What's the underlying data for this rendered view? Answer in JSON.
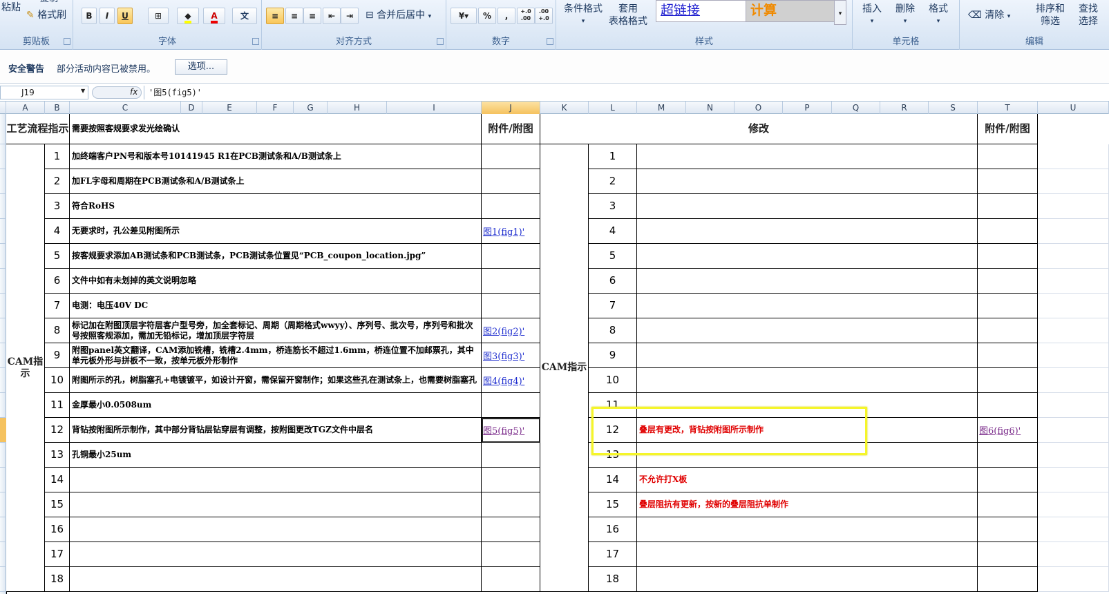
{
  "ribbon": {
    "paste_label": "粘贴",
    "copy_label": "复制",
    "format_painter_label": "格式刷",
    "clipboard_group": "剪贴板",
    "font_group": "字体",
    "alignment_group": "对齐方式",
    "merge_center_label": "合并后居中",
    "number_group": "数字",
    "percent_label": "%",
    "comma_label": ",",
    "styles_group": "样式",
    "conditional_format_label": "条件格式",
    "table_format_label1": "套用",
    "table_format_label2": "表格格式",
    "hyperlink_style": "超链接",
    "calc_style": "计算",
    "cells_group": "单元格",
    "insert_label": "插入",
    "delete_label": "删除",
    "format_label": "格式",
    "editing_group": "编辑",
    "clear_label": "清除",
    "sort_label1": "排序和",
    "sort_label2": "筛选",
    "find_label1": "查找",
    "find_label2": "选择",
    "bold": "B",
    "italic": "I",
    "underline": "U",
    "font_color_letter": "A",
    "wen_char": "文",
    "decimal_inc": "+.0 .00",
    "decimal_dec": ".00 +.0"
  },
  "security": {
    "title": "安全警告",
    "message": "部分活动内容已被禁用。",
    "options_button": "选项..."
  },
  "formula_bar": {
    "name_box": "J19",
    "fx": "fx",
    "formula": "'图5(fig5)'"
  },
  "columns": [
    "A",
    "B",
    "C",
    "D",
    "E",
    "F",
    "G",
    "H",
    "I",
    "J",
    "K",
    "L",
    "M",
    "N",
    "O",
    "P",
    "Q",
    "R",
    "S",
    "T",
    "U"
  ],
  "sheet": {
    "left_header_process": "工艺流程指示",
    "left_header_desc": "需要按照客规要求发光绘确认",
    "left_header_attach": "附件/附图",
    "right_header_modify": "修改",
    "right_header_attach": "附件/附图",
    "left_group_label": "CAM指示",
    "right_group_label": "CAM指示",
    "left_rows": [
      {
        "num": "1",
        "text": "加终端客户PN号和版本号10141945 R1在PCB测试条和A/B测试条上",
        "link": ""
      },
      {
        "num": "2",
        "text": "加FL字母和周期在PCB测试条和A/B测试条上",
        "link": ""
      },
      {
        "num": "3",
        "text": "符合RoHS",
        "link": ""
      },
      {
        "num": "4",
        "text": "无要求时，孔公差见附图所示",
        "link": "图1(fig1)'"
      },
      {
        "num": "5",
        "text": "按客规要求添加AB测试条和PCB测试条，PCB测试条位置见“PCB_coupon_location.jpg”",
        "link": ""
      },
      {
        "num": "6",
        "text": "文件中如有未划掉的英文说明忽略",
        "link": ""
      },
      {
        "num": "7",
        "text": "电测：电压40V DC",
        "link": ""
      },
      {
        "num": "8",
        "text": "标记加在附图顶层字符层客户型号旁，加全套标记、周期（周期格式wwyy）、序列号、批次号，序列号和批次号按照客规添加，需加无铅标记，增加顶层字符层",
        "link": "图2(fig2)'"
      },
      {
        "num": "9",
        "text": "附图panel英文翻译，CAM添加铣槽，铣槽2.4mm，桥连筋长不超过1.6mm，桥连位置不加邮票孔，其中单元板外形与拼板不一致，按单元板外形制作",
        "link": "图3(fig3)'"
      },
      {
        "num": "10",
        "text": "附图所示的孔，树脂塞孔+电镀镀平，如设计开窗，需保留开窗制作；如果这些孔在测试条上，也需要树脂塞孔",
        "link": "图4(fig4)'"
      },
      {
        "num": "11",
        "text": "金厚最小0.0508um",
        "link": ""
      },
      {
        "num": "12",
        "text": "背钻按附图所示制作，其中部分背钻层钻穿层有调整，按附图更改TGZ文件中层名",
        "link": "图5(fig5)'"
      },
      {
        "num": "13",
        "text": "孔铜最小25um",
        "link": ""
      },
      {
        "num": "14",
        "text": "",
        "link": ""
      },
      {
        "num": "15",
        "text": "",
        "link": ""
      },
      {
        "num": "16",
        "text": "",
        "link": ""
      },
      {
        "num": "17",
        "text": "",
        "link": ""
      },
      {
        "num": "18",
        "text": "",
        "link": ""
      }
    ],
    "right_rows": [
      {
        "num": "1",
        "text": "",
        "link": ""
      },
      {
        "num": "2",
        "text": "",
        "link": ""
      },
      {
        "num": "3",
        "text": "",
        "link": ""
      },
      {
        "num": "4",
        "text": "",
        "link": ""
      },
      {
        "num": "5",
        "text": "",
        "link": ""
      },
      {
        "num": "6",
        "text": "",
        "link": ""
      },
      {
        "num": "7",
        "text": "",
        "link": ""
      },
      {
        "num": "8",
        "text": "",
        "link": ""
      },
      {
        "num": "9",
        "text": "",
        "link": ""
      },
      {
        "num": "10",
        "text": "",
        "link": ""
      },
      {
        "num": "11",
        "text": "",
        "link": ""
      },
      {
        "num": "12",
        "text": "叠层有更改，背钻按附图所示制作",
        "link": "图6(fig6)'"
      },
      {
        "num": "13",
        "text": "",
        "link": ""
      },
      {
        "num": "14",
        "text": "不允许打X板",
        "link": ""
      },
      {
        "num": "15",
        "text": "叠层阻抗有更新，按新的叠层阻抗单制作",
        "link": ""
      },
      {
        "num": "16",
        "text": "",
        "link": ""
      },
      {
        "num": "17",
        "text": "",
        "link": ""
      },
      {
        "num": "18",
        "text": "",
        "link": ""
      }
    ]
  },
  "colors": {
    "highlight_box": "#f5f52a",
    "red_text": "#e00000",
    "link": "#1f2ecf",
    "selected_header": "#f5c25f"
  }
}
